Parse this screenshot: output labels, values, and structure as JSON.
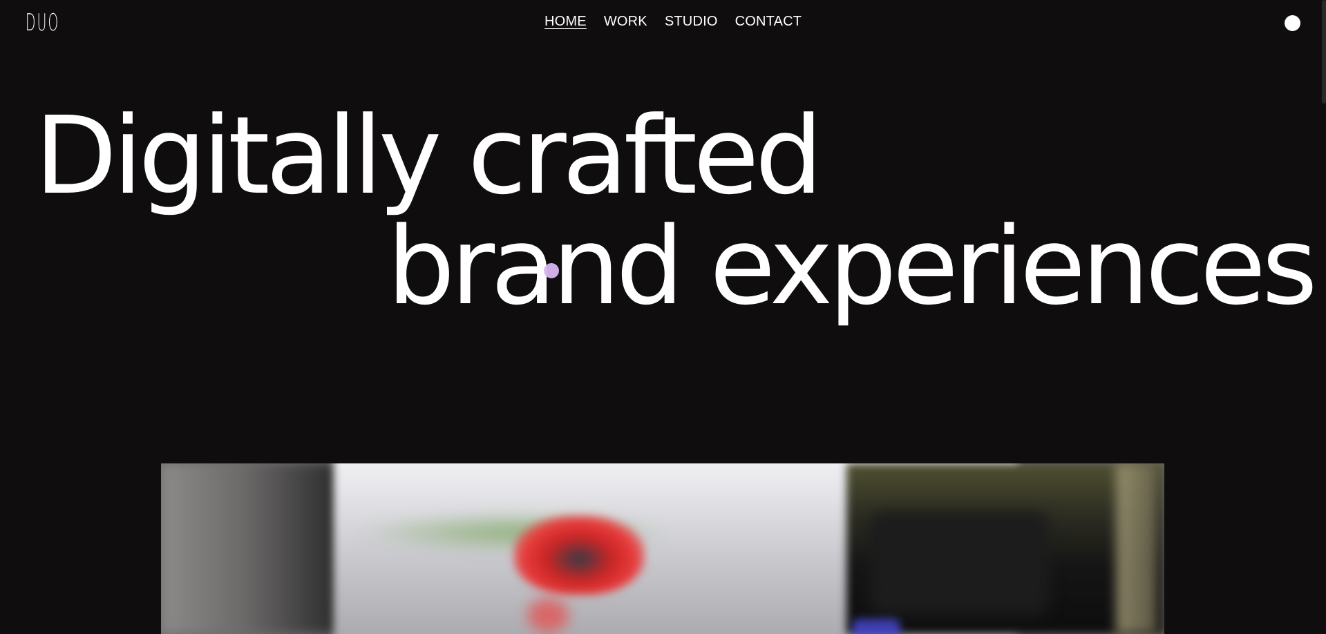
{
  "header": {
    "logo": "DUO",
    "nav": [
      {
        "label": "HOME",
        "active": true
      },
      {
        "label": "WORK",
        "active": false
      },
      {
        "label": "STUDIO",
        "active": false
      },
      {
        "label": "CONTACT",
        "active": false
      }
    ],
    "menu_icon": "circle-menu-icon"
  },
  "hero": {
    "headline_line1": "Digitally crafted",
    "headline_line2": "brand experiences",
    "media_icon": "video-thumbnail"
  },
  "colors": {
    "background": "#0f0d0e",
    "text": "#ffffff",
    "cursor_accent": "#d9b7f0"
  }
}
